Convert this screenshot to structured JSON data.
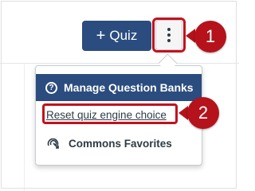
{
  "toolbar": {
    "quiz_button_plus": "+",
    "quiz_button_label": "Quiz",
    "options_icon": "kebab-vertical-icon"
  },
  "menu": {
    "items": [
      {
        "label": "Manage Question Banks",
        "icon": "question-circle-icon",
        "icon_glyph": "?",
        "state": "highlighted"
      },
      {
        "label": "Reset quiz engine choice",
        "icon": "",
        "state": "annotated"
      },
      {
        "label": "Commons Favorites",
        "icon": "commons-icon",
        "state": "normal"
      }
    ]
  },
  "annotations": {
    "step_1": "1",
    "step_2": "2",
    "color": "#b5121b"
  },
  "colors": {
    "primary_button": "#2b4c7e",
    "menu_highlight": "#2b4c7e",
    "annotation_red": "#b5121b",
    "text": "#2d3b45"
  }
}
